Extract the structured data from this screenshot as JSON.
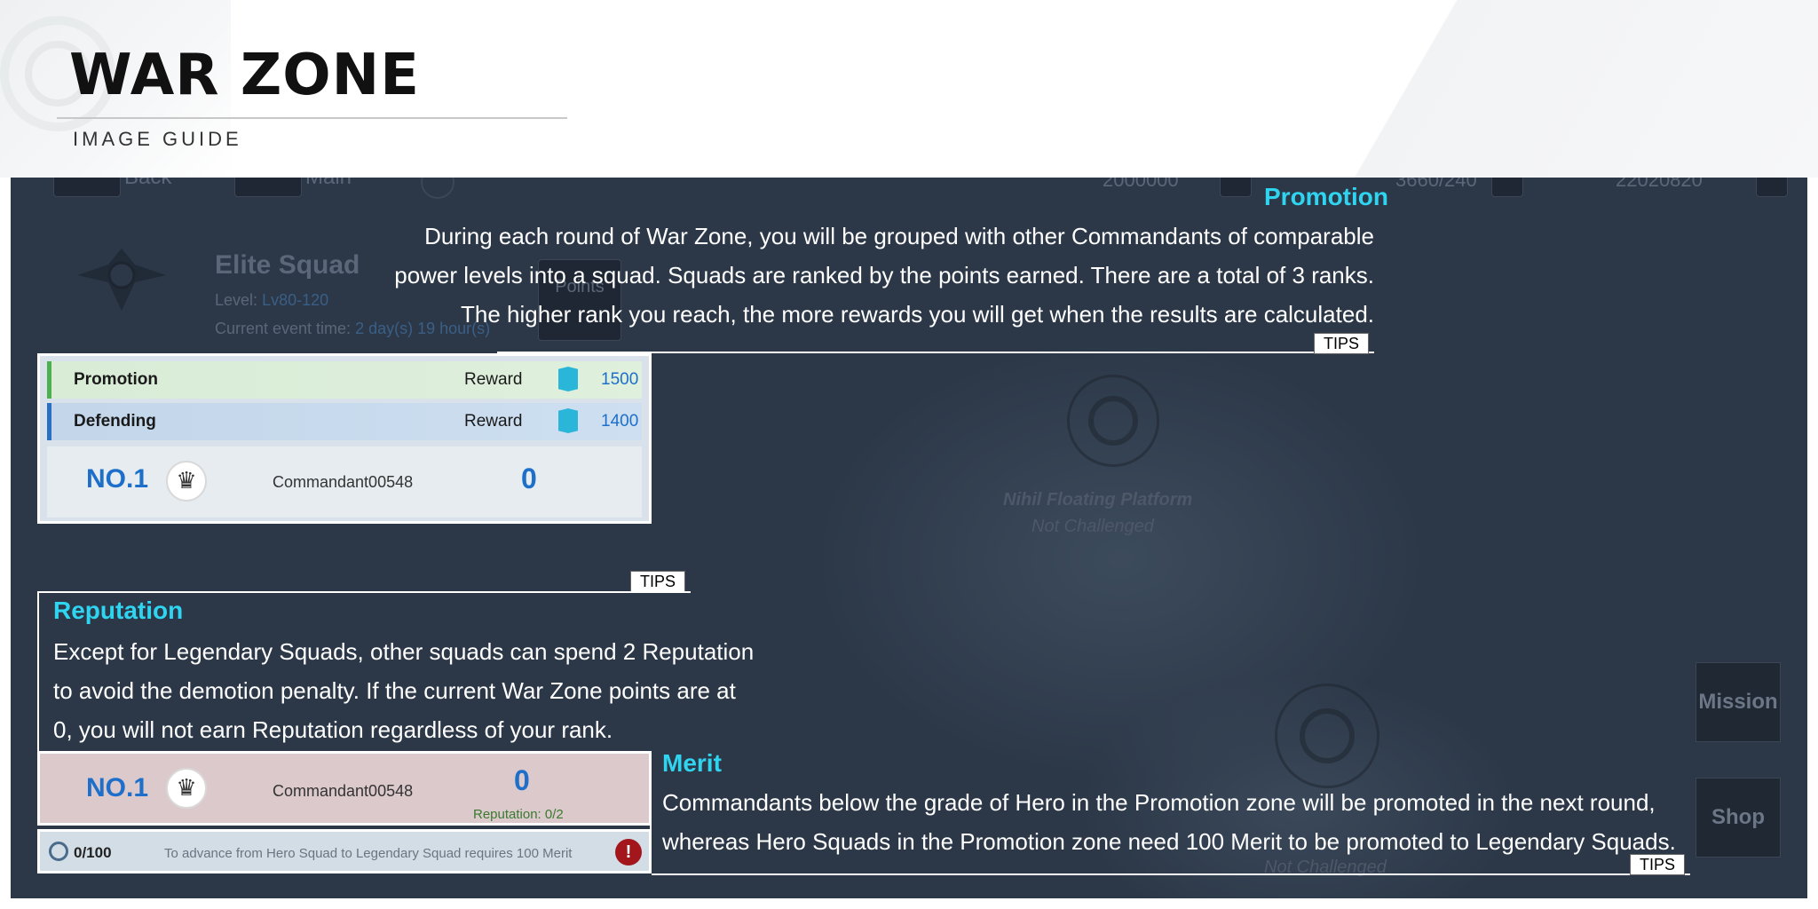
{
  "header": {
    "title": "WAR ZONE",
    "subtitle": "IMAGE GUIDE"
  },
  "background_ui": {
    "back_label": "Back",
    "main_label": "Main",
    "squad_name": "Elite Squad",
    "level_label": "Level:",
    "level_value": "Lv80-120",
    "event_time_label": "Current event time:",
    "event_time_value": "2 day(s) 19 hour(s)",
    "points_button": "Points",
    "currency_1": "2000000",
    "currency_2": "3660/240",
    "currency_3": "22020820",
    "map_node_name": "Nihil Floating Platform",
    "map_node_status": "Not Challenged",
    "map_node2_status": "Not Challenged",
    "mission_button": "Mission",
    "shop_button": "Shop"
  },
  "tips": {
    "tag": "TIPS",
    "promotion": {
      "title": "Promotion",
      "line1": "During each round of War Zone, you will be grouped with other Commandants of comparable",
      "line2": "power levels into a squad. Squads are ranked by the points earned. There are a total of 3 ranks.",
      "line3": "The higher rank you reach, the more rewards you will get when the results are calculated."
    },
    "reputation": {
      "title": "Reputation",
      "line1": "Except for Legendary Squads, other squads can spend 2 Reputation",
      "line2": "to avoid the demotion penalty. If the current War Zone points are at",
      "line3": "0, you will not earn Reputation regardless of your rank."
    },
    "merit": {
      "title": "Merit",
      "line1": "Commandants below the grade of Hero in the Promotion zone will be promoted in the next round,",
      "line2": "whereas Hero Squads in the Promotion zone need 100 Merit to be promoted to Legendary Squads."
    }
  },
  "rank_panel": {
    "promotion_label": "Promotion",
    "defending_label": "Defending",
    "reward_label": "Reward",
    "promotion_reward": "1500",
    "defending_reward": "1400",
    "rank": "NO.1",
    "commandant": "Commandant00548",
    "score": "0"
  },
  "reputation_panel": {
    "rank": "NO.1",
    "commandant": "Commandant00548",
    "score": "0",
    "reputation": "Reputation: 0/2"
  },
  "merit_bar": {
    "progress": "0/100",
    "progress_fraction": 0,
    "message": "To advance from Hero Squad to Legendary Squad requires 100 Merit",
    "alert_icon": "!"
  },
  "colors": {
    "accent": "#2fd5f0",
    "rank_blue": "#1e6fc9",
    "promotion_green": "#4caf50",
    "defending_blue": "#2a6fc4"
  }
}
